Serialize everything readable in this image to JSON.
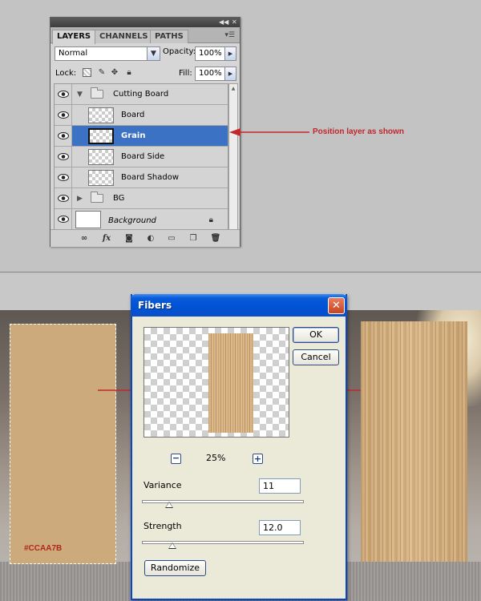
{
  "layers_panel": {
    "tabs": [
      {
        "label": "LAYERS"
      },
      {
        "label": "CHANNELS"
      },
      {
        "label": "PATHS"
      }
    ],
    "blend_mode": "Normal",
    "opacity_label": "Opacity:",
    "opacity_value": "100%",
    "lock_label": "Lock:",
    "fill_label": "Fill:",
    "fill_value": "100%",
    "layers": [
      {
        "name": "Cutting Board",
        "type": "group",
        "expanded": true
      },
      {
        "name": "Board",
        "type": "layer"
      },
      {
        "name": "Grain",
        "type": "layer",
        "selected": true
      },
      {
        "name": "Board Side",
        "type": "layer"
      },
      {
        "name": "Board Shadow",
        "type": "layer"
      },
      {
        "name": "BG",
        "type": "group",
        "expanded": false
      },
      {
        "name": "Background",
        "type": "background",
        "locked": true
      }
    ],
    "footer_icons": [
      "link-icon",
      "fx-icon",
      "mask-icon",
      "adjustment-icon",
      "folder-icon",
      "new-layer-icon",
      "trash-icon"
    ]
  },
  "annotation": {
    "text": "Position layer as shown",
    "color": "#c1272d"
  },
  "swatch": {
    "color": "#ccaa7b",
    "label": "#CCAA7B"
  },
  "fibers_dialog": {
    "title": "Fibers",
    "ok_label": "OK",
    "cancel_label": "Cancel",
    "zoom_value": "25%",
    "variance_label": "Variance",
    "variance_value": "11",
    "strength_label": "Strength",
    "strength_value": "12.0",
    "randomize_label": "Randomize",
    "variance_slider_level": 0.17,
    "strength_slider_level": 0.19
  }
}
